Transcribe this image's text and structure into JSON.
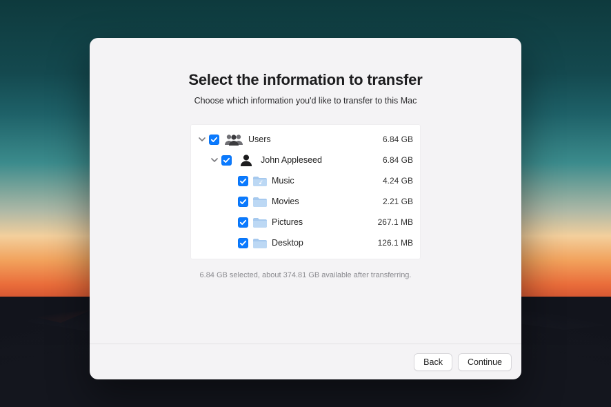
{
  "heading": "Select the information to transfer",
  "subheading": "Choose which information you'd like to transfer to this Mac",
  "tree": {
    "root": {
      "label": "Users",
      "size": "6.84 GB"
    },
    "user": {
      "label": "John Appleseed",
      "size": "6.84 GB"
    },
    "items": [
      {
        "label": "Music",
        "size": "4.24 GB",
        "icon": "music"
      },
      {
        "label": "Movies",
        "size": "2.21 GB",
        "icon": "folder"
      },
      {
        "label": "Pictures",
        "size": "267.1 MB",
        "icon": "folder"
      },
      {
        "label": "Desktop",
        "size": "126.1 MB",
        "icon": "folder"
      }
    ]
  },
  "status": "6.84 GB selected, about 374.81 GB available after transferring.",
  "buttons": {
    "back": "Back",
    "continue": "Continue"
  }
}
